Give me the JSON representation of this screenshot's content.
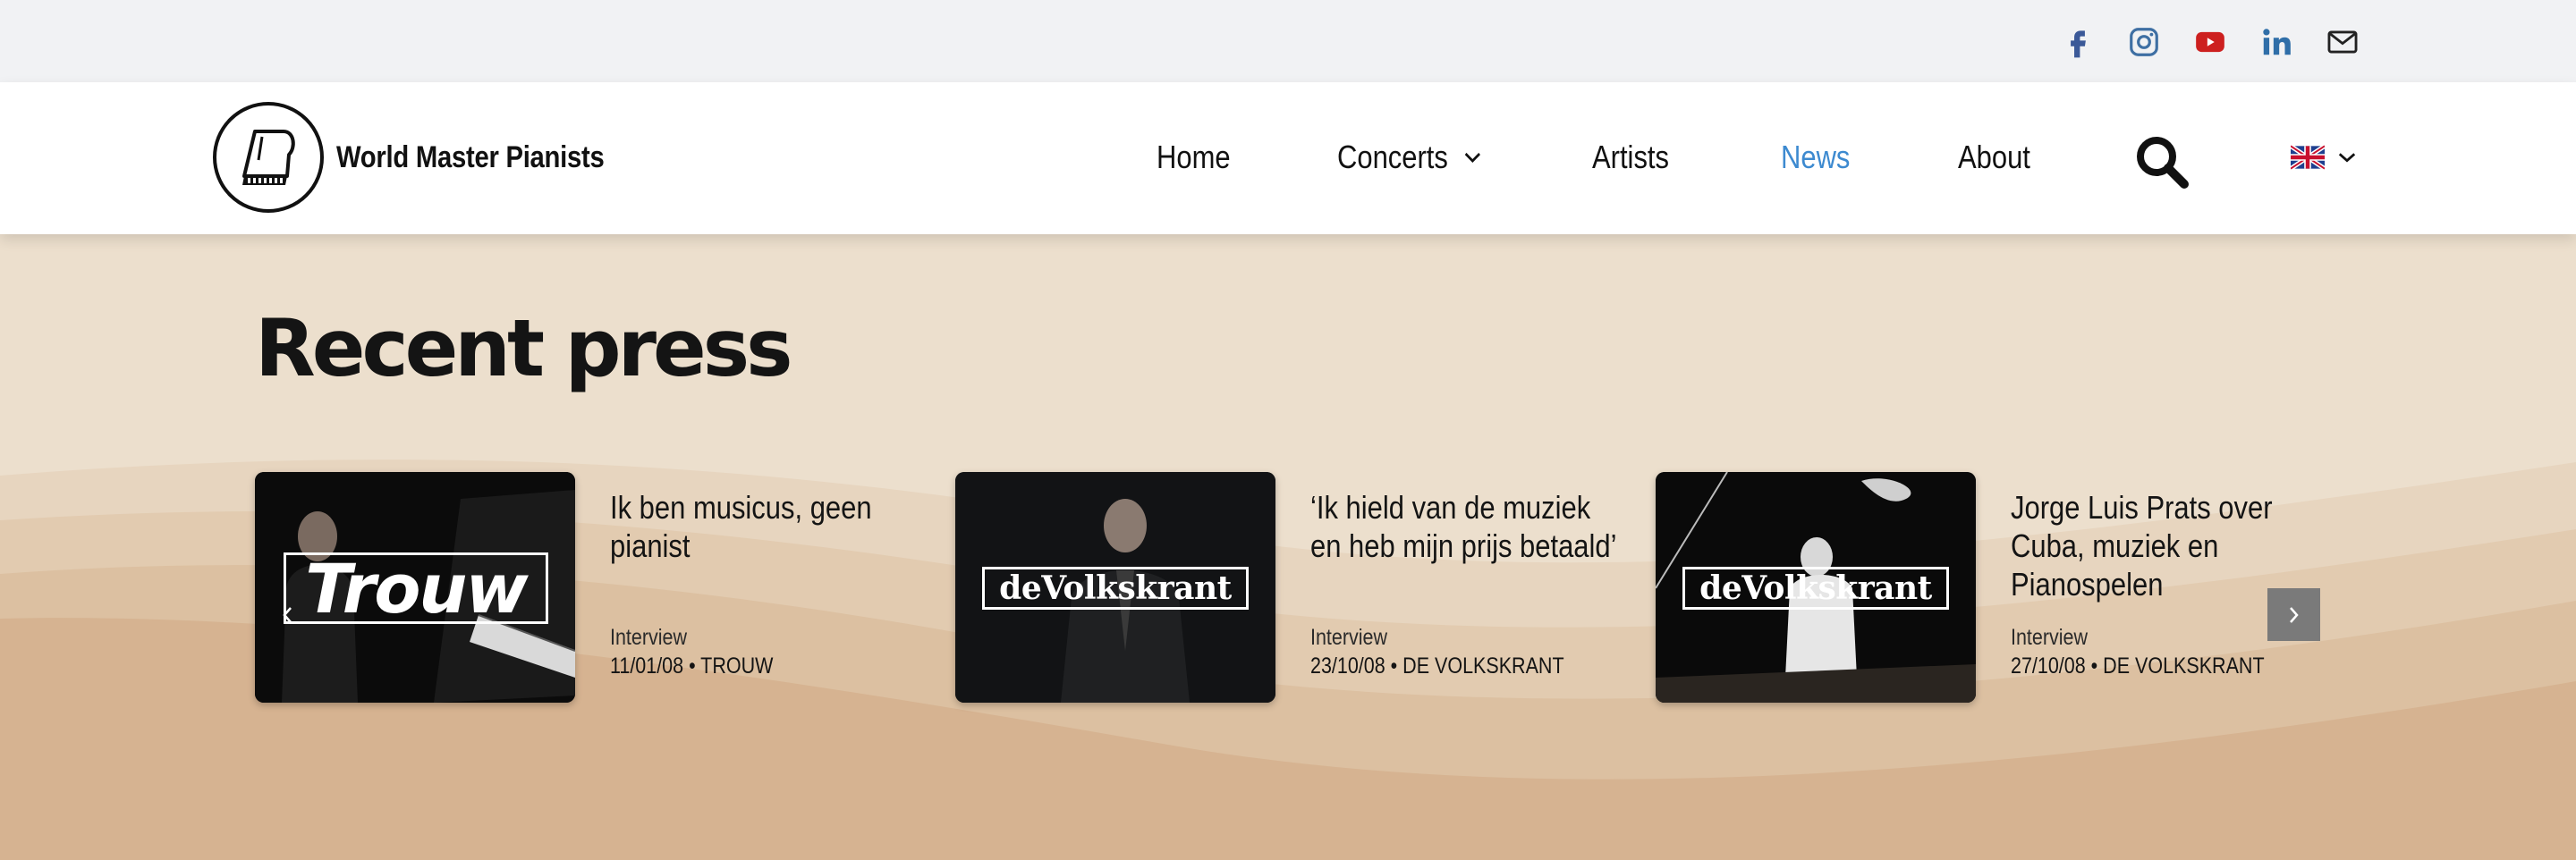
{
  "social": [
    {
      "icon": "facebook-icon",
      "color": "#3b5998"
    },
    {
      "icon": "instagram-icon",
      "color": "#3e6fa3"
    },
    {
      "icon": "youtube-icon",
      "color": "#cd201f"
    },
    {
      "icon": "linkedin-icon",
      "color": "#2f6ea8"
    },
    {
      "icon": "mail-icon",
      "color": "#222222"
    }
  ],
  "header": {
    "logo_text": "World Master Pianists",
    "nav": [
      {
        "label": "Home",
        "active": false
      },
      {
        "label": "Concerts",
        "active": false,
        "has_dropdown": true
      },
      {
        "label": "Artists",
        "active": false
      },
      {
        "label": "News",
        "active": true
      },
      {
        "label": "About",
        "active": false
      }
    ],
    "language": "en-flag",
    "accent_color": "#3d8ad0"
  },
  "main": {
    "heading": "Recent press",
    "cards": [
      {
        "source_logo": "Trouw",
        "title": "Ik ben musicus, geen pianist",
        "type": "Interview",
        "date_source": "11/01/08 • TROUW"
      },
      {
        "source_logo": "deVolkskrant",
        "title": "‘Ik hield van de muziek en heb mijn prijs betaald’",
        "type": "Interview",
        "date_source": "23/10/08 • DE VOLKSKRANT"
      },
      {
        "source_logo": "deVolkskrant",
        "title": "Jorge Luis Prats over Cuba, muziek en Pianospelen",
        "type": "Interview",
        "date_source": "27/10/08 • DE VOLKSKRANT"
      }
    ],
    "next_label": "›",
    "prev_label": "‹"
  }
}
